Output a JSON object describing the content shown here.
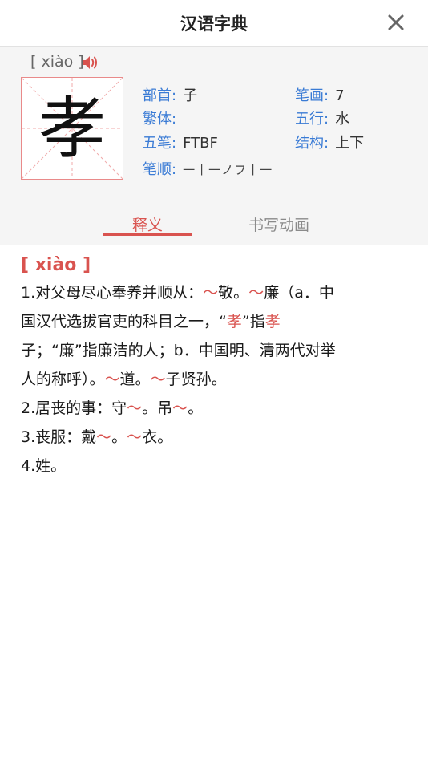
{
  "header": {
    "title": "汉语字典"
  },
  "character": {
    "glyph": "孝",
    "pinyin_display": "[ xiào ]",
    "radical_label": "部首:",
    "radical": "子",
    "strokes_label": "笔画:",
    "strokes": "7",
    "traditional_label": "繁体:",
    "traditional": "",
    "five_elements_label": "五行:",
    "five_elements": "水",
    "wubi_label": "五笔:",
    "wubi": "FTBF",
    "structure_label": "结构:",
    "structure": "上下",
    "stroke_order_label": "笔顺:",
    "stroke_order": "一丨一ノフ丨一"
  },
  "tabs": [
    {
      "label": "释义",
      "active": true
    },
    {
      "label": "书写动画",
      "active": false
    }
  ],
  "definition": {
    "pinyin": "[ xiào ]",
    "lines": [
      {
        "segments": [
          {
            "t": "1.对父母尽心奉养并顺从："
          },
          {
            "t": "～",
            "red": true
          },
          {
            "t": "敬。"
          },
          {
            "t": "～",
            "red": true
          },
          {
            "t": "廉（a．中"
          }
        ]
      },
      {
        "segments": [
          {
            "t": "国汉代选拔官吏的科目之一，“"
          },
          {
            "t": "孝",
            "red": true
          },
          {
            "t": "”指"
          },
          {
            "t": "孝",
            "red": true
          }
        ]
      },
      {
        "segments": [
          {
            "t": "子；“廉”指廉洁的人；b．中国明、清两代对举"
          }
        ]
      },
      {
        "segments": [
          {
            "t": "人的称呼）。"
          },
          {
            "t": "～",
            "red": true
          },
          {
            "t": "道。"
          },
          {
            "t": "～",
            "red": true
          },
          {
            "t": "子贤孙。"
          }
        ]
      },
      {
        "segments": [
          {
            "t": "2.居丧的事：守"
          },
          {
            "t": "～",
            "red": true
          },
          {
            "t": "。吊"
          },
          {
            "t": "～",
            "red": true
          },
          {
            "t": "。"
          }
        ]
      },
      {
        "segments": [
          {
            "t": "3.丧服：戴"
          },
          {
            "t": "～",
            "red": true
          },
          {
            "t": "。"
          },
          {
            "t": "～",
            "red": true
          },
          {
            "t": "衣。"
          }
        ]
      },
      {
        "segments": [
          {
            "t": "4.姓。"
          }
        ]
      }
    ]
  },
  "colors": {
    "accent": "#d9534f",
    "label_blue": "#3a7bd5"
  },
  "icons": {
    "close": "close-icon",
    "speaker": "speaker-icon"
  }
}
